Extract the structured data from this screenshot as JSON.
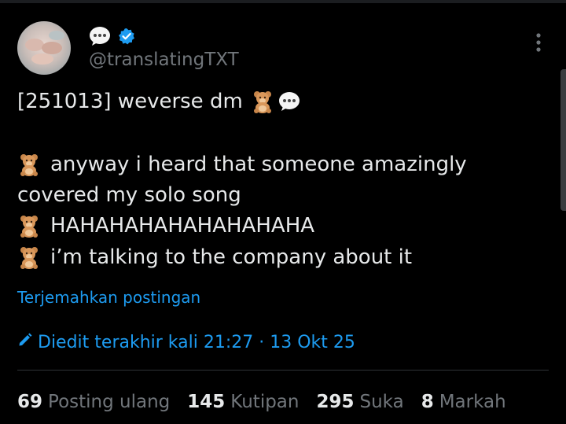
{
  "header": {
    "handle": "@translatingTXT"
  },
  "tweet": {
    "line1": "[251013] weverse dm",
    "line2": "anyway i heard that someone amazingly",
    "line3": "covered my solo song",
    "line4": "HAHAHAHAHAHAHAHAHA",
    "line5": "i’m talking to the company about it"
  },
  "translate_link": "Terjemahkan postingan",
  "edited": {
    "text": "Diedit terakhir kali 21:27 · 13 Okt 25"
  },
  "stats": [
    {
      "count": "69",
      "label": "Posting ulang"
    },
    {
      "count": "145",
      "label": "Kutipan"
    },
    {
      "count": "295",
      "label": "Suka"
    },
    {
      "count": "8",
      "label": "Markah"
    }
  ],
  "colors": {
    "background": "#000000",
    "text": "#e7e9ea",
    "secondary": "#71767b",
    "accent": "#1d9bf0",
    "divider": "#2f3336"
  },
  "icons": {
    "display_name_icon": "speech-bubble-icon",
    "verified": "verified-badge-icon",
    "more": "more-vertical-icon",
    "tweet_emoji": "teddy-bear-icon",
    "edit": "pencil-icon"
  }
}
